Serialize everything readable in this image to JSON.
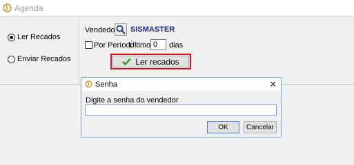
{
  "window": {
    "title": "Agenda"
  },
  "left_panel": {
    "options": [
      {
        "label": "Ler Recados",
        "checked": true
      },
      {
        "label": "Enviar Recados",
        "checked": false
      }
    ]
  },
  "filters": {
    "seller_label": "Vendedor:",
    "seller_value": "SISMASTER",
    "period_label": "Por Período",
    "last_label": "Últimos",
    "days_value": "0",
    "days_label": "dias"
  },
  "actions": {
    "read_label": "Ler recados"
  },
  "dialog": {
    "title": "Senha",
    "close_glyph": "✕",
    "prompt": "Digite a senha do vendedor",
    "password_value": "",
    "ok_label": "OK",
    "cancel_label": "Cancelar"
  },
  "colors": {
    "accent": "#e0101a",
    "seller_text": "#1a2c7a"
  }
}
